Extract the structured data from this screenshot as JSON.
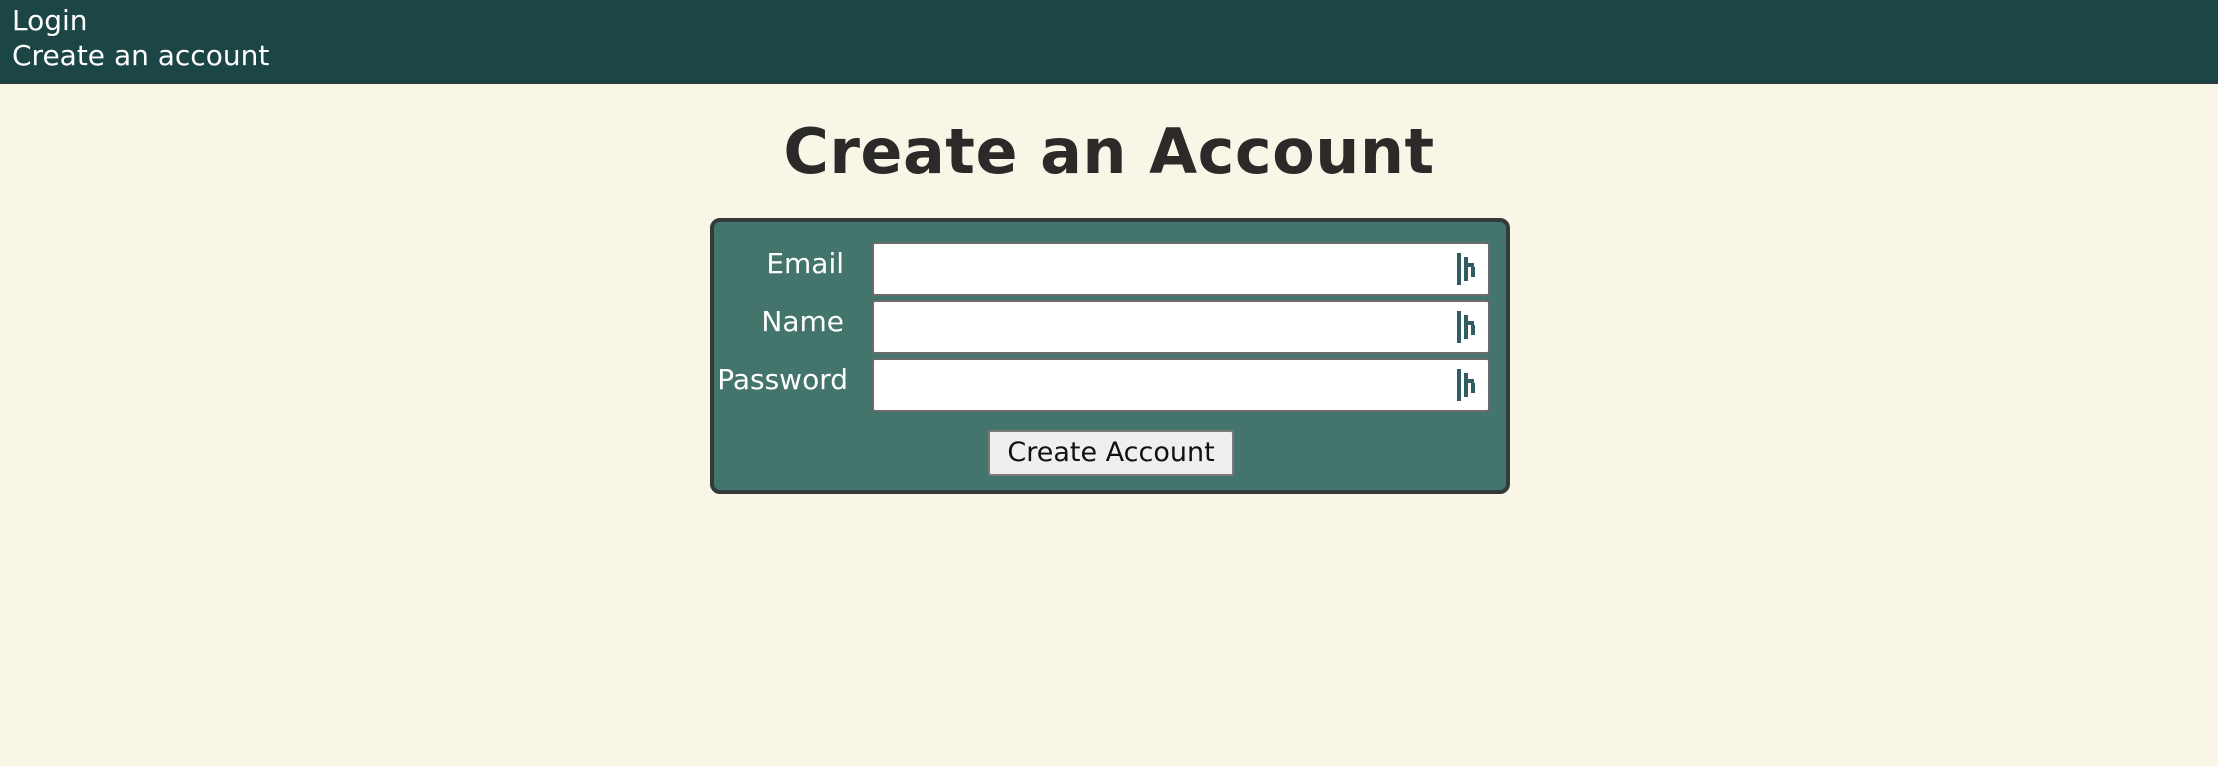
{
  "nav": {
    "login_label": "Login",
    "create_account_label": "Create an account"
  },
  "page": {
    "title": "Create an Account"
  },
  "form": {
    "fields": [
      {
        "label": "Email",
        "value": "",
        "placeholder": ""
      },
      {
        "label": "Name",
        "value": "",
        "placeholder": ""
      },
      {
        "label": "Password",
        "value": "",
        "placeholder": ""
      }
    ],
    "submit_label": "Create Account",
    "field_icon": "password-manager-icon"
  },
  "colors": {
    "topbar": "#1c4545",
    "background": "#f9f5e7",
    "panel": "#44756d",
    "panel_border": "#333a38",
    "title_text": "#2b2a28",
    "icon_accent": "#2f5d63"
  }
}
